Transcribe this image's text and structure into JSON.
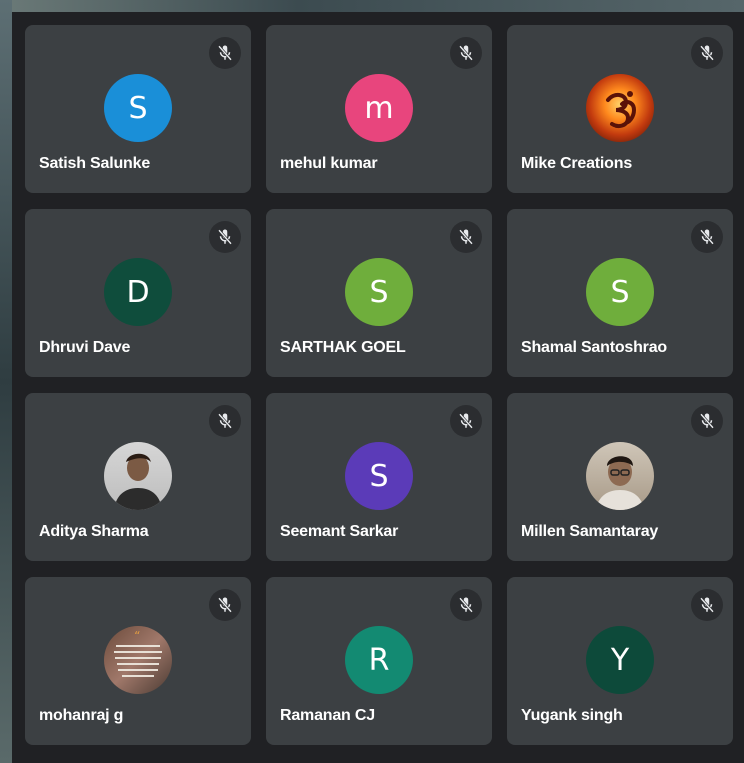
{
  "participants": [
    {
      "name": "Satish Salunke",
      "initial": "S",
      "avatar_type": "letter",
      "color": "#1a8fd8",
      "muted": true
    },
    {
      "name": "mehul kumar",
      "initial": "m",
      "avatar_type": "letter",
      "color": "#e8457d",
      "muted": true
    },
    {
      "name": "Mike Creations",
      "initial": "",
      "avatar_type": "photo-om-flame",
      "color": "#c23a0e",
      "muted": true
    },
    {
      "name": "Dhruvi Dave",
      "initial": "D",
      "avatar_type": "letter",
      "color": "#0f4d3c",
      "muted": true
    },
    {
      "name": "SARTHAK GOEL",
      "initial": "S",
      "avatar_type": "letter",
      "color": "#6fae3c",
      "muted": true
    },
    {
      "name": "Shamal Santoshrao",
      "initial": "S",
      "avatar_type": "letter",
      "color": "#6fae3c",
      "muted": true
    },
    {
      "name": "Aditya Sharma",
      "initial": "",
      "avatar_type": "photo-person",
      "color": "#9b9b9b",
      "muted": true
    },
    {
      "name": "Seemant Sarkar",
      "initial": "S",
      "avatar_type": "letter",
      "color": "#5b3bb8",
      "muted": true
    },
    {
      "name": "Millen Samantaray",
      "initial": "",
      "avatar_type": "photo-person",
      "color": "#b7a99a",
      "muted": true
    },
    {
      "name": "mohanraj g",
      "initial": "",
      "avatar_type": "photo-quote",
      "color": "#8a6a55",
      "muted": true
    },
    {
      "name": "Ramanan CJ",
      "initial": "R",
      "avatar_type": "letter",
      "color": "#138a72",
      "muted": true
    },
    {
      "name": "Yugank singh",
      "initial": "Y",
      "avatar_type": "letter",
      "color": "#0d4a3a",
      "muted": true
    }
  ]
}
